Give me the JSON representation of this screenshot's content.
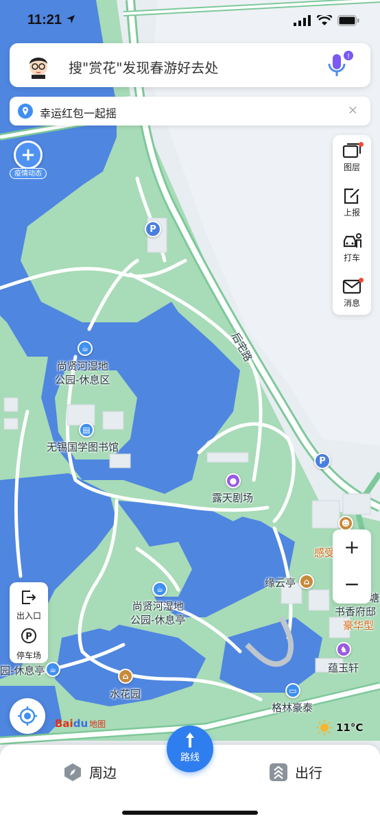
{
  "status_bar": {
    "time": "11:21"
  },
  "search": {
    "placeholder_text": "搜\"赏花\"发现春游好去处"
  },
  "banner": {
    "text": "幸运红包一起摇",
    "close": "×"
  },
  "epidemic": {
    "label": "疫情动态"
  },
  "right_toolbar": [
    {
      "label": "图层",
      "icon": "layers-icon",
      "badge": true
    },
    {
      "label": "上报",
      "icon": "report-icon",
      "badge": false
    },
    {
      "label": "打车",
      "icon": "taxi-icon",
      "badge": false
    },
    {
      "label": "消息",
      "icon": "message-icon",
      "badge": true
    }
  ],
  "zoom": {
    "in": "+",
    "out": "−"
  },
  "left_toolbar": [
    {
      "label": "出入口",
      "icon": "entrance-icon"
    },
    {
      "label": "停车场",
      "icon": "parking-icon"
    }
  ],
  "map_labels": {
    "road": "后宅路",
    "rest_area_1": "尚贤河湿地\n公园-休息区",
    "library": "无锡国学图书馆",
    "theater": "露天剧场",
    "rest_pavilion": "尚贤河湿地\n公园-休息亭",
    "yuanyun": "缘云亭",
    "shuihuayuan": "水花园",
    "shuxiang_1": "塘",
    "shuxiang_2": "书香府邸",
    "haohuaxing": "豪华型",
    "yunyuxuan": "蕴玉轩",
    "gelinhaotai": "格林豪泰",
    "ganshou": "感受",
    "left_edge": "园-休息亭",
    "parking_p": "P"
  },
  "logo": {
    "bai": "Bai",
    "du": "du",
    "ditu": "地图"
  },
  "weather": {
    "temp": "11°C"
  },
  "bottom_bar": {
    "nearby": "周边",
    "route": "路线",
    "travel": "出行"
  },
  "colors": {
    "water": "#4f86e0",
    "land": "#a5d9b5",
    "road": "#ffffff",
    "accent": "#2f7ef0"
  }
}
